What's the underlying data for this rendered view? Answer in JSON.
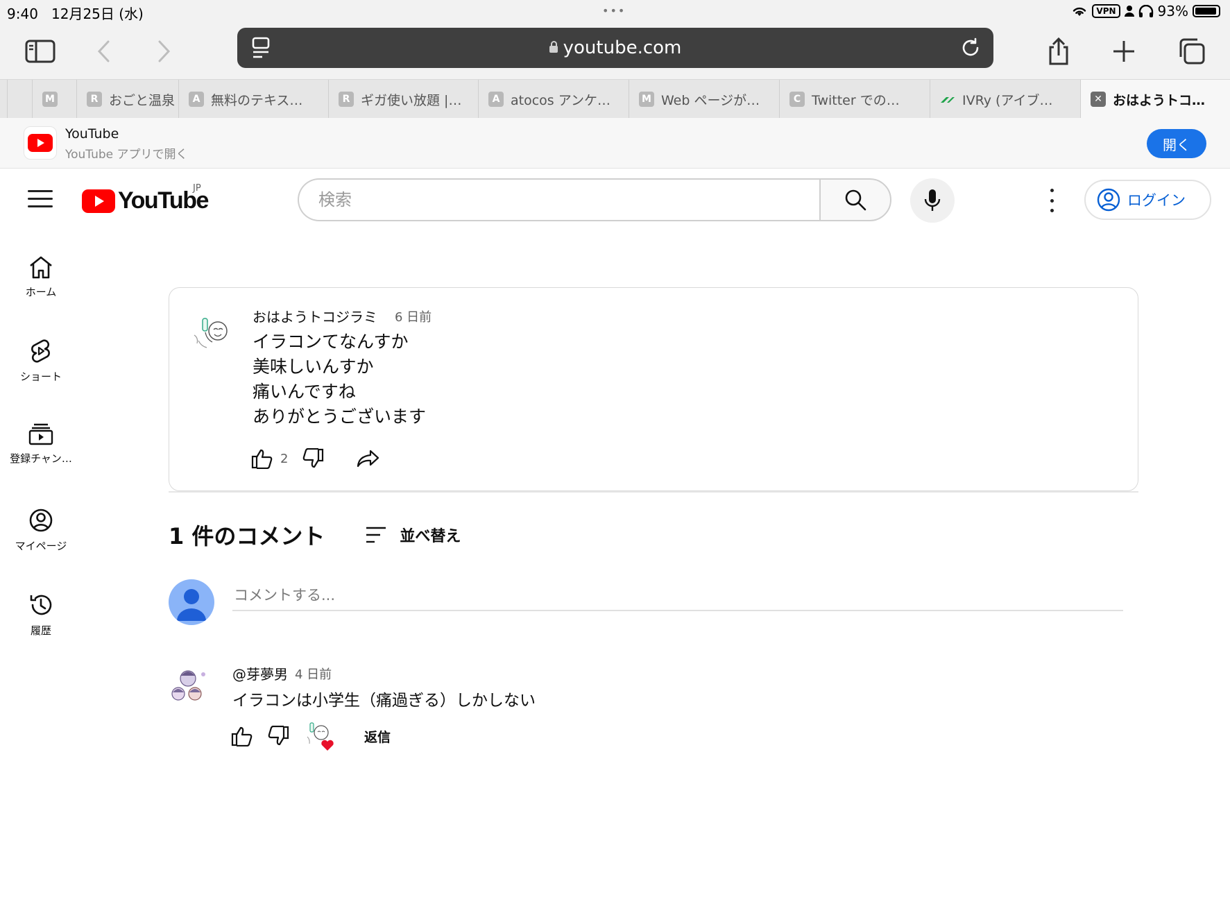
{
  "status_bar": {
    "time": "9:40",
    "date": "12月25日 (水)",
    "vpn": "VPN",
    "battery": "93%",
    "battery_level": 0.93
  },
  "browser": {
    "url": "youtube.com",
    "icons": [
      "sidebar-icon",
      "back-icon",
      "forward-icon",
      "reader-icon",
      "reload-icon",
      "share-icon",
      "new-tab-icon",
      "tabs-icon"
    ],
    "tabs": [
      {
        "fav": "M",
        "label": ""
      },
      {
        "fav": "R",
        "label": "おごと温泉"
      },
      {
        "fav": "A",
        "label": "無料のテキス…"
      },
      {
        "fav": "R",
        "label": "ギガ使い放題 |…"
      },
      {
        "fav": "A",
        "label": "atocos アンケ…"
      },
      {
        "fav": "M",
        "label": "Web ページが…"
      },
      {
        "fav": "C",
        "label": "Twitter での…"
      },
      {
        "fav": "",
        "label": "IVRy (アイブ…"
      },
      {
        "fav": "✕",
        "label": "おはようトコ…"
      }
    ]
  },
  "banner": {
    "app_name": "YouTube",
    "subtitle": "YouTube アプリで開く",
    "open_label": "開く"
  },
  "header": {
    "logo_text": "YouTube",
    "country": "JP",
    "search_placeholder": "検索",
    "login_label": "ログイン"
  },
  "sidebar": {
    "items": [
      {
        "label": "ホーム",
        "icon": "home-icon"
      },
      {
        "label": "ショート",
        "icon": "shorts-icon"
      },
      {
        "label": "登録チャン…",
        "icon": "subscriptions-icon"
      },
      {
        "label": "マイページ",
        "icon": "account-icon"
      },
      {
        "label": "履歴",
        "icon": "history-icon"
      }
    ]
  },
  "post": {
    "author": "おはようトコジラミ",
    "time": "6 日前",
    "lines": [
      "イラコンてなんすか",
      "美味しいんすか",
      "痛いんですね",
      "ありがとうございます"
    ],
    "likes": "2"
  },
  "comments": {
    "title": "1 件のコメント",
    "sort_label": "並べ替え",
    "add_placeholder": "コメントする...",
    "items": [
      {
        "author": "@芽夢男",
        "time": "4 日前",
        "text": "イラコンは小学生（痛過ぎる）しかしない",
        "reply_label": "返信"
      }
    ]
  },
  "colors": {
    "brand_red": "#ff0000",
    "link_blue": "#065fd4",
    "open_button": "#1a73e8"
  }
}
